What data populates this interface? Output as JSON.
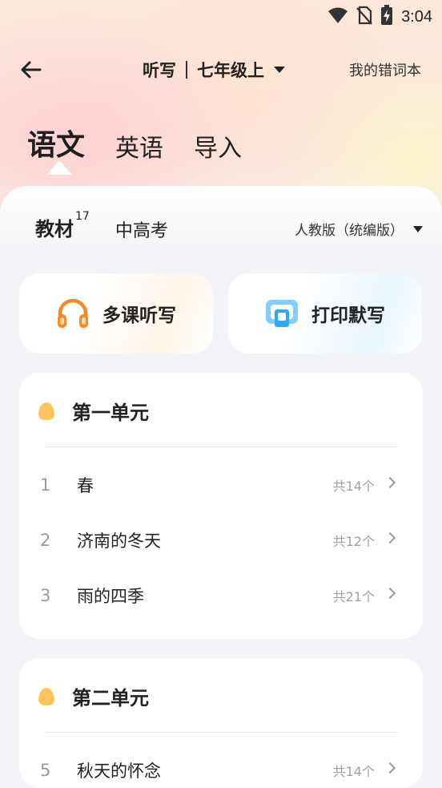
{
  "status": {
    "time": "3:04",
    "icons": [
      "wifi-icon",
      "no-sim-icon",
      "battery-charging-icon"
    ]
  },
  "nav": {
    "back_icon": "arrow-left-icon",
    "mode": "听写",
    "grade": "七年级上",
    "right_link": "我的错词本"
  },
  "subjects": [
    {
      "label": "语文",
      "active": true
    },
    {
      "label": "英语",
      "active": false
    },
    {
      "label": "导入",
      "active": false
    }
  ],
  "sub_tabs": {
    "textbook": "教材",
    "textbook_count": "17",
    "exam": "中高考",
    "edition": "人教版（统编版）"
  },
  "actions": {
    "left_label": "多课听写",
    "left_icon": "headphones-icon",
    "right_label": "打印默写",
    "right_icon": "print-icon"
  },
  "units": [
    {
      "title": "第一单元",
      "lessons": [
        {
          "num": "1",
          "name": "春",
          "count": "共14个"
        },
        {
          "num": "2",
          "name": "济南的冬天",
          "count": "共12个"
        },
        {
          "num": "3",
          "name": "雨的四季",
          "count": "共21个"
        }
      ]
    },
    {
      "title": "第二单元",
      "lessons": [
        {
          "num": "5",
          "name": "秋天的怀念",
          "count": "共14个"
        }
      ]
    }
  ],
  "colors": {
    "accent_orange": "#ffc45a",
    "headphone_orange": "#f7892b",
    "print_blue": "#2fa8f5"
  }
}
